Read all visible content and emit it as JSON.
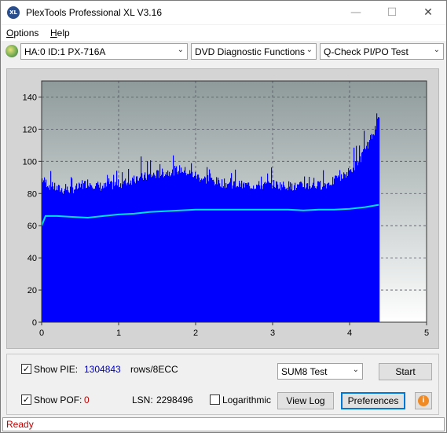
{
  "window": {
    "title": "PlexTools Professional XL V3.16",
    "icon_text": "XL",
    "controls": {
      "minimize": "—",
      "maximize": "☐",
      "close": "✕"
    }
  },
  "menu": [
    {
      "label": "Options",
      "mnemonic": "O",
      "rest": "ptions"
    },
    {
      "label": "Help",
      "mnemonic": "H",
      "rest": "elp"
    }
  ],
  "toolbar": {
    "drive": "HA:0 ID:1  PX-716A",
    "function": "DVD Diagnostic Functions",
    "test": "Q-Check PI/PO Test"
  },
  "chart_data": {
    "type": "area",
    "xlim": [
      0,
      5
    ],
    "ylim": [
      0,
      150
    ],
    "x_ticks": [
      0,
      1,
      2,
      3,
      4,
      5
    ],
    "y_ticks": [
      0,
      20,
      40,
      60,
      80,
      100,
      120,
      140
    ],
    "grid": true,
    "background": "gradient-gray",
    "series": [
      {
        "color": "#0000ff",
        "kind": "bars",
        "x": [
          0.0,
          0.1,
          0.2,
          0.3,
          0.4,
          0.5,
          0.6,
          0.7,
          0.8,
          0.9,
          1.0,
          1.1,
          1.2,
          1.3,
          1.4,
          1.5,
          1.6,
          1.7,
          1.8,
          1.9,
          2.0,
          2.1,
          2.2,
          2.3,
          2.4,
          2.5,
          2.6,
          2.7,
          2.8,
          2.9,
          3.0,
          3.1,
          3.2,
          3.3,
          3.4,
          3.5,
          3.6,
          3.7,
          3.8,
          3.9,
          4.0,
          4.1,
          4.2,
          4.3,
          4.38
        ],
        "values": [
          90,
          86,
          84,
          83,
          84,
          85,
          88,
          86,
          85,
          86,
          87,
          88,
          90,
          91,
          92,
          93,
          94,
          95,
          96,
          94,
          92,
          90,
          89,
          88,
          87,
          87,
          86,
          86,
          86,
          86,
          87,
          86,
          86,
          85,
          86,
          86,
          86,
          87,
          89,
          91,
          95,
          100,
          108,
          118,
          128
        ],
        "peaks": [
          100,
          94,
          96,
          92,
          90,
          95,
          99,
          96,
          94,
          95,
          98,
          100,
          102,
          104,
          106,
          108,
          107,
          105,
          104,
          102,
          101,
          99,
          97,
          96,
          95,
          96,
          94,
          93,
          95,
          94,
          97,
          95,
          94,
          93,
          94,
          95,
          96,
          98,
          101,
          103,
          107,
          113,
          122,
          133,
          145
        ]
      },
      {
        "color": "#00e0e0",
        "kind": "line",
        "x": [
          0.0,
          0.05,
          0.2,
          0.4,
          0.6,
          0.8,
          1.0,
          1.2,
          1.4,
          1.6,
          1.8,
          2.0,
          2.2,
          2.4,
          2.6,
          2.8,
          3.0,
          3.2,
          3.4,
          3.6,
          3.8,
          4.0,
          4.2,
          4.38
        ],
        "values": [
          60,
          66,
          66,
          65.5,
          65,
          66,
          67,
          67.5,
          68.5,
          69,
          69.5,
          70,
          70,
          70,
          70,
          70,
          70,
          70,
          69.5,
          70,
          70,
          70.5,
          71.5,
          73
        ]
      }
    ]
  },
  "controls": {
    "show_pie_label": "Show PIE:",
    "pie_value": "1304843",
    "rows_label": "rows/8ECC",
    "show_pof_label": "Show POF:",
    "pof_value": "0",
    "lsn_label": "LSN:",
    "lsn_value": "2298496",
    "logarithmic_label": "Logarithmic",
    "sum_test": "SUM8 Test",
    "start_label": "Start",
    "view_log_label": "View Log",
    "preferences_label": "Preferences",
    "show_pie_checked": true,
    "show_pof_checked": true,
    "logarithmic_checked": false
  },
  "status": {
    "text": "Ready",
    "color": "#c00000"
  },
  "colors": {
    "pie_value": "#0000c0",
    "pof_value": "#c00000"
  }
}
